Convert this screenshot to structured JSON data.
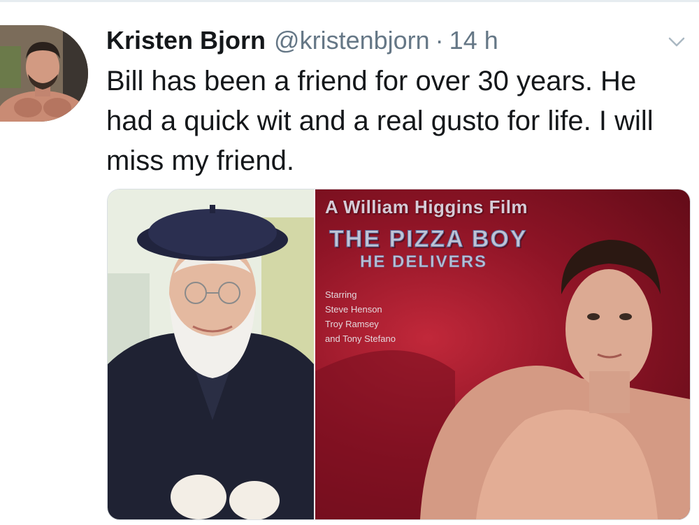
{
  "tweet": {
    "display_name": "Kristen Bjorn",
    "handle": "@kristenbjorn",
    "separator": "·",
    "time": "14 h",
    "text": "Bill has been a friend for over 30 years. He had a quick wit and a real gusto for life. I will miss my friend."
  },
  "poster": {
    "caption": "A William Higgins Film",
    "title": "THE PIZZA BOY",
    "subtitle": "HE DELIVERS",
    "credits": [
      "Starring",
      "Steve Henson",
      "Troy Ramsey",
      "and Tony Stefano"
    ]
  },
  "icons": {
    "menu": "chevron-down-icon"
  },
  "colors": {
    "text": "#14171a",
    "secondary": "#657786",
    "poster_red": "#8e1426"
  }
}
